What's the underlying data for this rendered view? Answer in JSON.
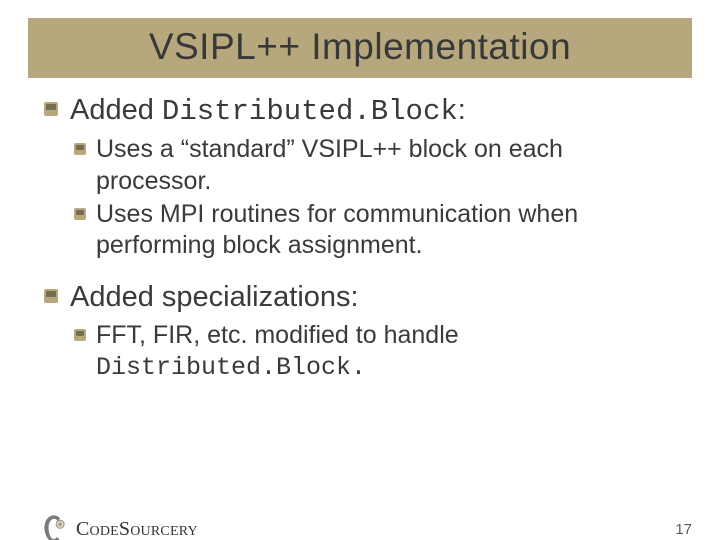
{
  "title": "VSIPL++ Implementation",
  "bullets": {
    "b1_prefix": "Added ",
    "b1_code": "Distributed.Block",
    "b1_suffix": ":",
    "b1_subs": [
      "Uses a “standard” VSIPL++ block on each processor.",
      "Uses MPI routines for communication when performing block assignment."
    ],
    "b2": "Added specializations:",
    "b2_sub_prefix": "FFT, FIR, etc. modified to handle ",
    "b2_sub_code": "Distributed.Block.",
    "b2_sub_suffix": ""
  },
  "footer": {
    "brand_code": "Code",
    "brand_sourcery": "Sourcery",
    "page_number": "17"
  }
}
